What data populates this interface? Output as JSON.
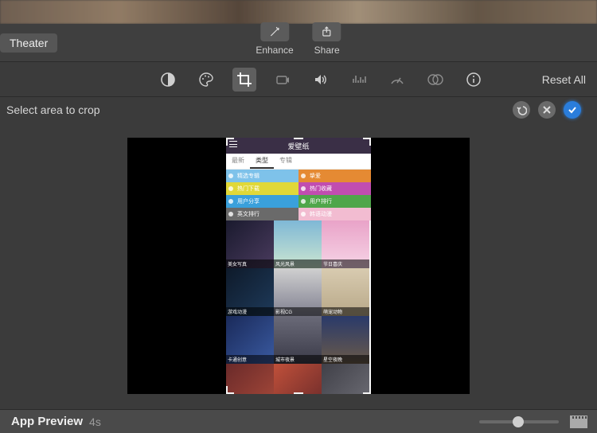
{
  "topbar": {
    "theater_label": "Theater",
    "enhance_label": "Enhance",
    "share_label": "Share"
  },
  "toolbar": {
    "reset_all": "Reset All"
  },
  "subbar": {
    "hint": "Select area to crop"
  },
  "phone": {
    "title": "爱壁纸",
    "tabs": [
      "最新",
      "类型",
      "专辑"
    ],
    "cats": [
      [
        {
          "label": "精选专辑",
          "color": "#7ec2ea"
        },
        {
          "label": "挚爱",
          "color": "#e58a33"
        }
      ],
      [
        {
          "label": "热门下载",
          "color": "#e0d838"
        },
        {
          "label": "热门收藏",
          "color": "#c14db0"
        }
      ],
      [
        {
          "label": "用户分享",
          "color": "#3aa0db"
        },
        {
          "label": "用户排行",
          "color": "#4fa64a"
        }
      ],
      [
        {
          "label": "英文排行",
          "color": "#6a6a6a"
        },
        {
          "label": "韩语动漫",
          "color": "#f2bcd1"
        }
      ]
    ],
    "tiles": [
      {
        "label": "美女写真",
        "bg": "linear-gradient(135deg,#1a1a2e,#4a3b5e)"
      },
      {
        "label": "风光风景",
        "bg": "linear-gradient(180deg,#7fb8d6,#cbe5d0)"
      },
      {
        "label": "节日喜庆",
        "bg": "linear-gradient(180deg,#e9a3c8,#f6d4e6)"
      },
      {
        "label": "游戏动漫",
        "bg": "linear-gradient(135deg,#0e1a2a,#1e3a5a)"
      },
      {
        "label": "影视CG",
        "bg": "linear-gradient(180deg,#d0d0d0,#808090)"
      },
      {
        "label": "萌宠动物",
        "bg": "linear-gradient(180deg,#d8cbb0,#b8a888)"
      },
      {
        "label": "卡通创意",
        "bg": "linear-gradient(135deg,#1a2a5a,#3a5aa0)"
      },
      {
        "label": "城市夜景",
        "bg": "linear-gradient(180deg,#6a6a78,#3a3a48)"
      },
      {
        "label": "星空夜晚",
        "bg": "linear-gradient(180deg,#2a3a6a,#6a5a4a)"
      },
      {
        "label": "",
        "bg": "linear-gradient(135deg,#6a2a2a,#a84a3a)"
      },
      {
        "label": "",
        "bg": "linear-gradient(135deg,#c0503a,#6a2a2a)"
      },
      {
        "label": "",
        "bg": "linear-gradient(135deg,#404048,#707078)"
      }
    ]
  },
  "bottombar": {
    "title": "App Preview",
    "time": "4s"
  }
}
